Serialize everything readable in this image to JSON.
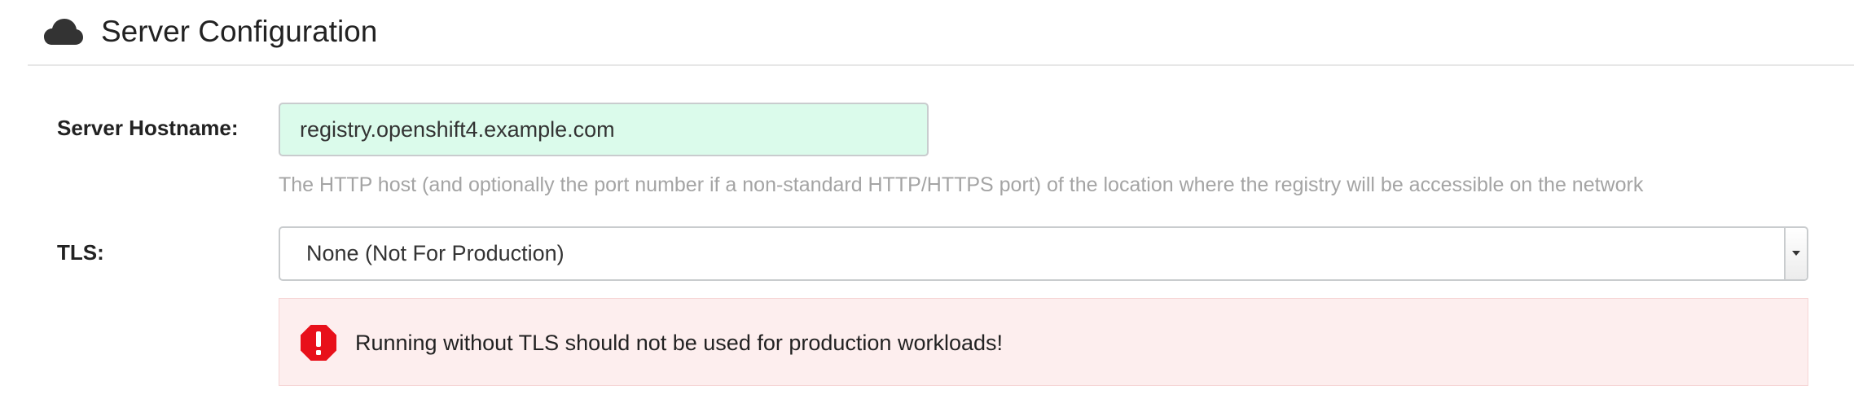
{
  "header": {
    "icon": "cloud-icon",
    "title": "Server Configuration"
  },
  "server_hostname": {
    "label": "Server Hostname:",
    "value": "registry.openshift4.example.com",
    "help_text": "The HTTP host (and optionally the port number if a non-standard HTTP/HTTPS port) of the location where the registry will be accessible on the network"
  },
  "tls": {
    "label": "TLS:",
    "selected": "None (Not For Production)",
    "dropdown_icon": "chevron-down-icon"
  },
  "alert": {
    "icon": "alert-octagon-icon",
    "message": "Running without TLS should not be used for production workloads!"
  },
  "colors": {
    "input_valid_bg": "#dbfbeb",
    "alert_bg": "#fdeeee",
    "alert_icon": "#e8101a",
    "help_text": "#a4a4a4"
  }
}
